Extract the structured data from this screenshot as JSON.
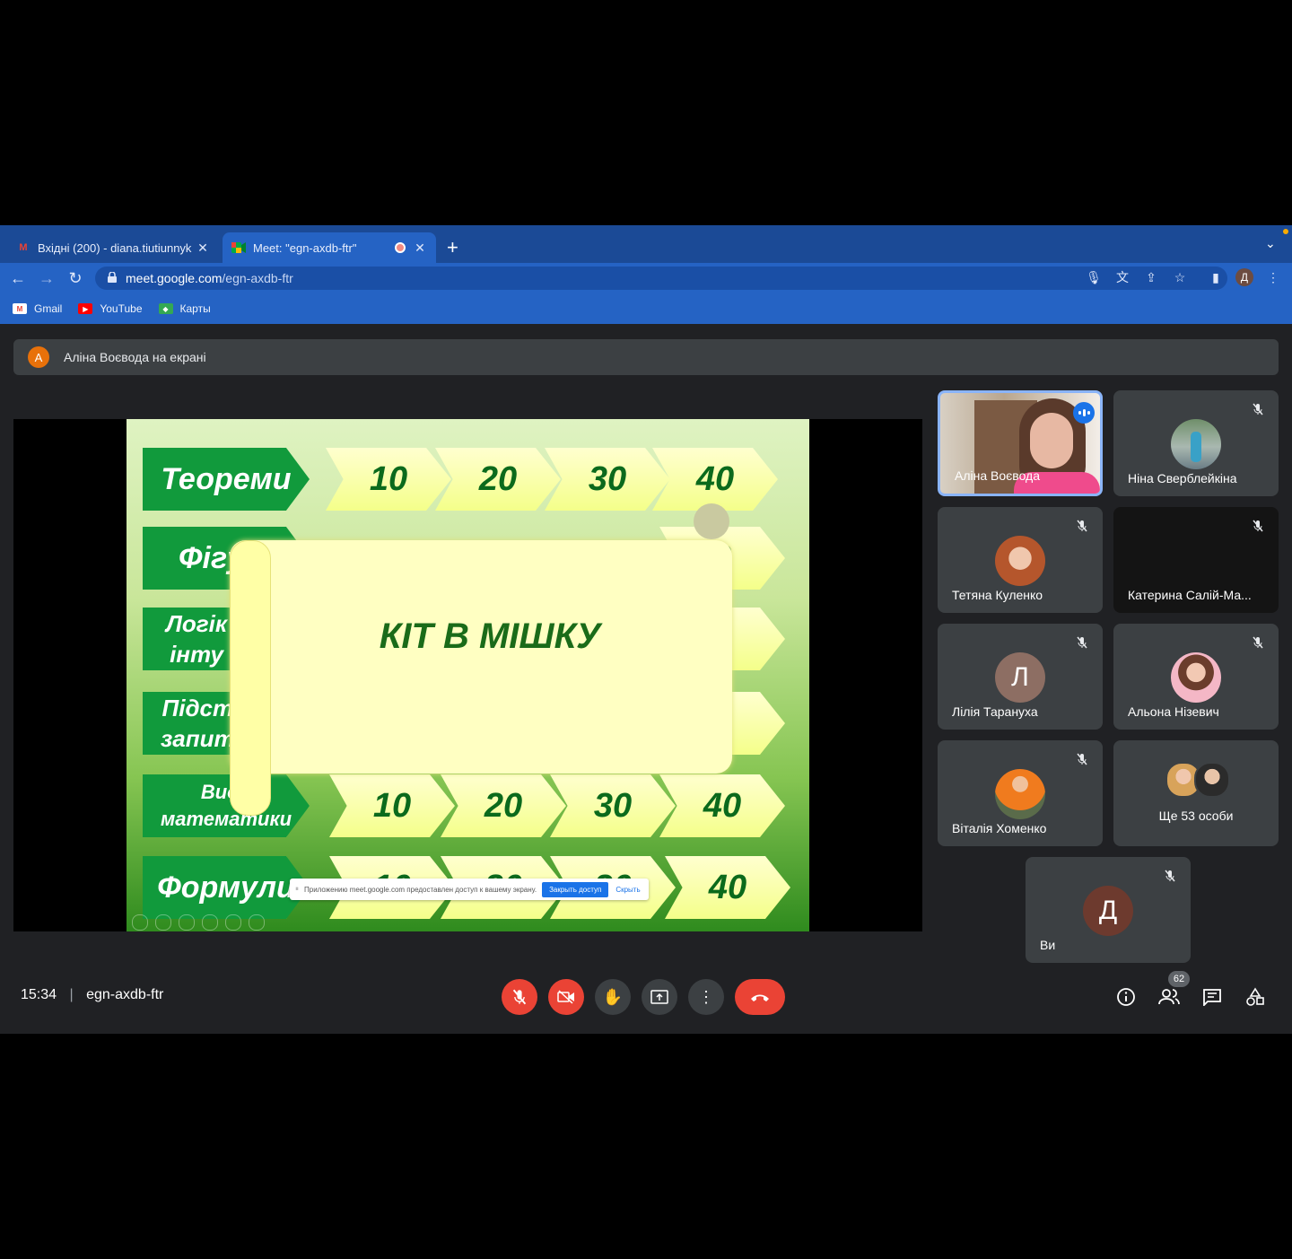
{
  "browser": {
    "tabs": [
      {
        "title": "Вхідні (200) - diana.tiutiunnyk",
        "icon": "gmail-icon",
        "active": false
      },
      {
        "title": "Meet: \"egn-axdb-ftr\"",
        "icon": "meet-icon",
        "active": true
      }
    ],
    "url_host": "meet.google.com",
    "url_path": "/egn-axdb-ftr",
    "profile_initial": "Д",
    "bookmarks": [
      {
        "label": "Gmail",
        "icon": "gmail-icon"
      },
      {
        "label": "YouTube",
        "icon": "youtube-icon"
      },
      {
        "label": "Карты",
        "icon": "maps-icon"
      }
    ]
  },
  "meet": {
    "presenter_banner": {
      "initial": "А",
      "text": "Аліна Воєвода на екрані"
    },
    "slide": {
      "categories": [
        "Теореми",
        "Фігу",
        "Логік\nінту",
        "Підст\nзапит",
        "Види\nматематики",
        "Формули"
      ],
      "row_values": [
        [
          "10",
          "20",
          "30",
          "40"
        ],
        [
          "",
          "",
          "",
          "0"
        ],
        [
          "",
          "",
          "",
          "0"
        ],
        [
          "",
          "",
          "",
          "0"
        ],
        [
          "10",
          "20",
          "30",
          "40"
        ],
        [
          "10",
          "20",
          "30",
          "40"
        ]
      ],
      "scroll_title": "КІТ В МІШКУ",
      "share_notice": {
        "text": "Приложению meet.google.com предоставлен доступ к вашему экрану.",
        "stop_label": "Закрыть доступ",
        "hide_label": "Скрыть"
      }
    },
    "participants": [
      {
        "name": "Аліна Воєвода",
        "speaking": true
      },
      {
        "name": "Ніна Сверблейкіна"
      },
      {
        "name": "Тетяна Куленко"
      },
      {
        "name": "Катерина Салій-Ма..."
      },
      {
        "name": "Лілія Тарануха",
        "initial": "Л"
      },
      {
        "name": "Альона Нізевич"
      },
      {
        "name": "Віталія Хоменко"
      },
      {
        "name": "Ще 53 особи"
      },
      {
        "name": "Ви",
        "initial": "Д"
      }
    ],
    "footer": {
      "time": "15:34",
      "meeting_code": "egn-axdb-ftr",
      "participant_count": "62"
    },
    "colors": {
      "danger": "#ea4335",
      "surface": "#3c4043",
      "background": "#202124"
    }
  }
}
